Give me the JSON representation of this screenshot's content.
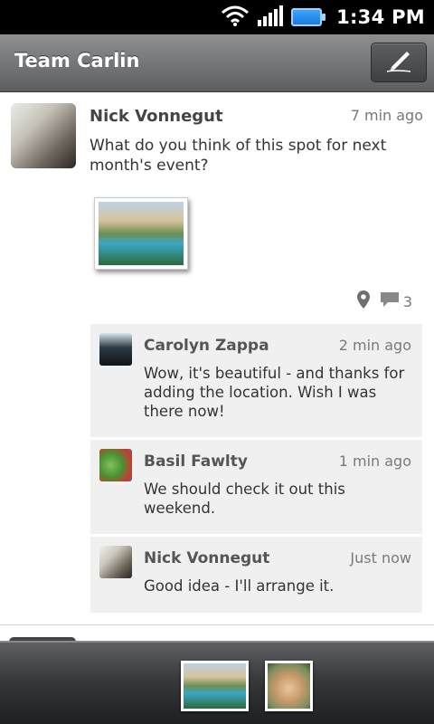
{
  "status_bar": {
    "time": "1:34 PM",
    "icons": [
      "wifi-icon",
      "signal-icon",
      "battery-icon"
    ]
  },
  "header": {
    "title": "Team Carlin",
    "compose_icon": "pen-icon"
  },
  "post": {
    "author": "Nick Vonnegut",
    "time": "7 min ago",
    "body": "What do you think of this spot for next month's event?",
    "comment_count": "3",
    "meta_icons": [
      "location-pin-icon",
      "comment-icon"
    ]
  },
  "replies": [
    {
      "author": "Carolyn Zappa",
      "time": "2 min ago",
      "body": "Wow, it's beautiful - and thanks for adding the location.  Wish I was there now!"
    },
    {
      "author": "Basil Fawlty",
      "time": "1 min ago",
      "body": "We should check it out this weekend."
    },
    {
      "author": "Nick Vonnegut",
      "time": "Just now",
      "body": "Good idea - I'll arrange it."
    }
  ],
  "colors": {
    "title_bar": "#6e6f72",
    "reply_background": "#f0f0f0",
    "status_bar": "#000000"
  }
}
